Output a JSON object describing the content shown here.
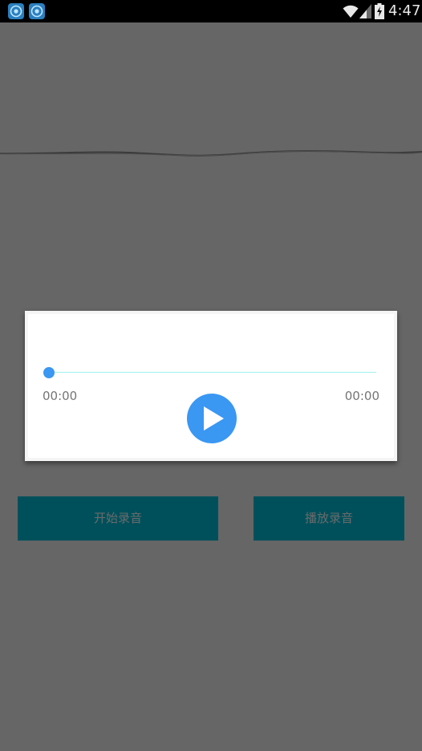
{
  "status_bar": {
    "time": "4:47",
    "notification_icons": [
      "app-notification-icon",
      "app-notification-icon"
    ],
    "icons": [
      "wifi-icon",
      "signal-icon",
      "battery-charging-icon"
    ]
  },
  "player": {
    "current_time": "00:00",
    "total_time": "00:00",
    "progress": 0,
    "play_icon": "play-icon",
    "colors": {
      "accent": "#3a97f2",
      "track": "#9ef2ee"
    }
  },
  "buttons": {
    "start_recording": "开始录音",
    "play_recording": "播放录音"
  },
  "colors": {
    "overlay_background": "#666666",
    "button_background": "#00505b",
    "button_text": "#6b6b6b"
  }
}
